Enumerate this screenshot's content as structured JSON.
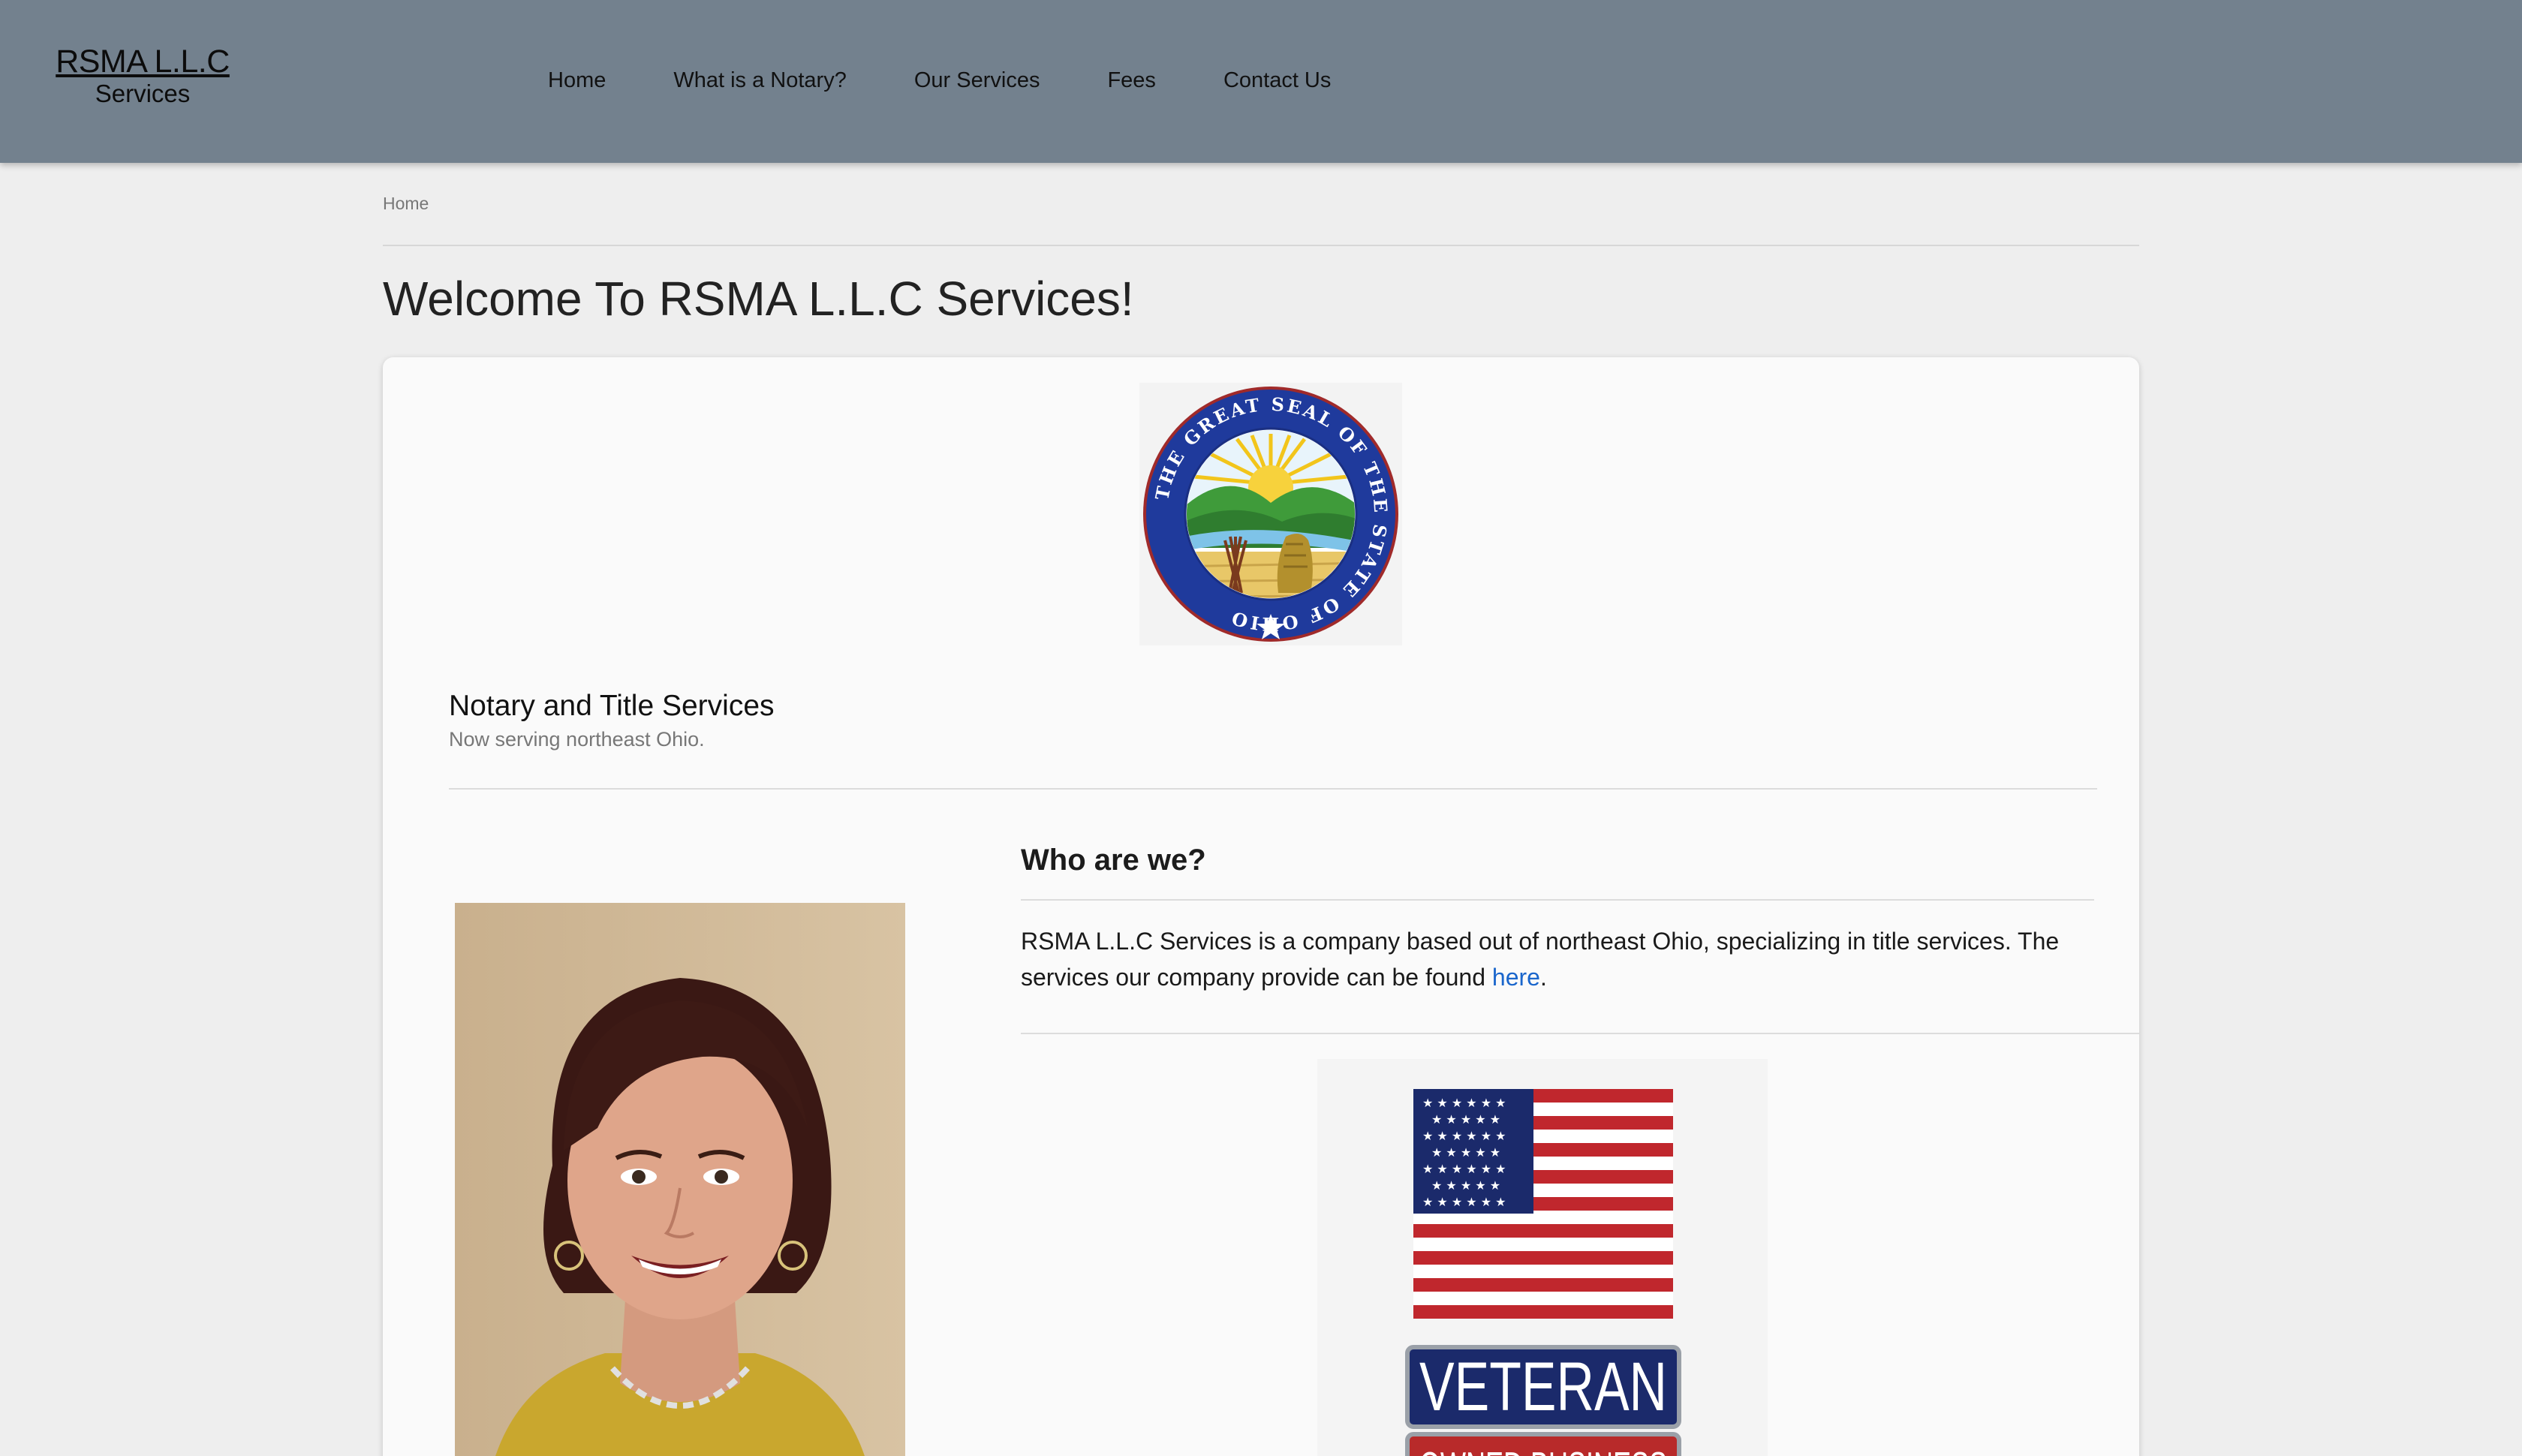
{
  "header": {
    "logo_main": "RSMA L.L.C",
    "logo_sub": "Services",
    "nav": [
      "Home",
      "What is a Notary?",
      "Our Services",
      "Fees",
      "Contact Us"
    ]
  },
  "breadcrumb": "Home",
  "page_title": "Welcome To RSMA L.L.C Services!",
  "seal": {
    "text": "THE GREAT SEAL OF THE STATE OF OHIO",
    "icon": "ohio-seal-image"
  },
  "notary_section": {
    "title": "Notary and Title Services",
    "subtitle": "Now serving northeast Ohio."
  },
  "who": {
    "title": "Who are we?",
    "text_before": "RSMA L.L.C Services is a company based out of northeast Ohio, specializing in title services. The services our company provide can be found ",
    "link": "here",
    "text_after": "."
  },
  "veteran_badge": {
    "line1": "VETERAN",
    "line2": "OWNED BUSINESS"
  },
  "colors": {
    "header_bg": "#73818e",
    "page_bg": "#eeeeee",
    "link": "#1a66cc",
    "flag_blue": "#1b2a6b",
    "flag_red": "#b82a2a"
  }
}
